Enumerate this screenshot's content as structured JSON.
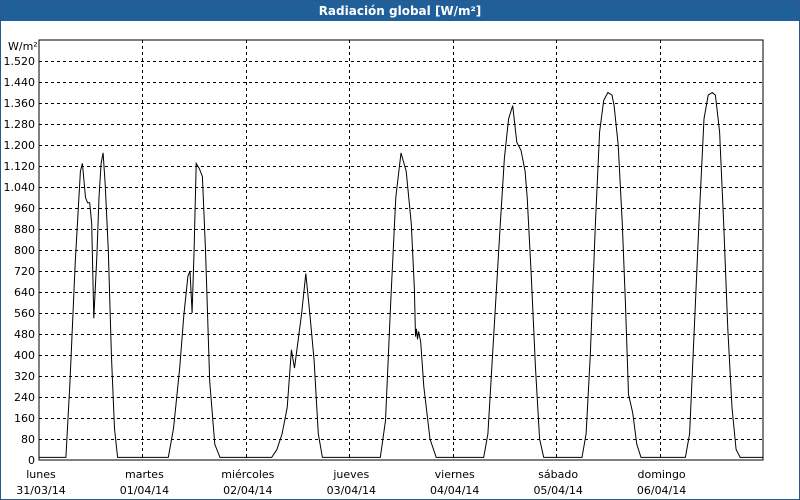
{
  "window": {
    "title": "Radiación global [W/m²]"
  },
  "chart_data": {
    "type": "line",
    "title": "Radiación global [W/m²]",
    "ylabel": "W/m²",
    "xlabel": "",
    "ylim": [
      0,
      1600
    ],
    "xlim": [
      0,
      7
    ],
    "grid": true,
    "y_ticks": [
      0,
      80,
      160,
      240,
      320,
      400,
      480,
      560,
      640,
      720,
      800,
      880,
      960,
      1040,
      1120,
      1200,
      1280,
      1360,
      1440,
      1520
    ],
    "y_tick_labels": [
      "0",
      "80",
      "160",
      "240",
      "320",
      "400",
      "480",
      "560",
      "640",
      "720",
      "800",
      "880",
      "960",
      "1.040",
      "1.120",
      "1.200",
      "1.280",
      "1.360",
      "1.440",
      "1.520"
    ],
    "x_ticks": [
      {
        "day": "lunes",
        "date": "31/03/14"
      },
      {
        "day": "martes",
        "date": "01/04/14"
      },
      {
        "day": "miércoles",
        "date": "02/04/14"
      },
      {
        "day": "jueves",
        "date": "03/04/14"
      },
      {
        "day": "viernes",
        "date": "04/04/14"
      },
      {
        "day": "sábado",
        "date": "05/04/14"
      },
      {
        "day": "domingo",
        "date": "06/04/14"
      }
    ],
    "series": [
      {
        "line_color": "#000000",
        "points": [
          [
            0.0,
            10
          ],
          [
            0.2,
            10
          ],
          [
            0.26,
            10
          ],
          [
            0.3,
            300
          ],
          [
            0.35,
            750
          ],
          [
            0.4,
            1100
          ],
          [
            0.42,
            1130
          ],
          [
            0.45,
            1000
          ],
          [
            0.47,
            980
          ],
          [
            0.49,
            980
          ],
          [
            0.51,
            900
          ],
          [
            0.53,
            540
          ],
          [
            0.56,
            780
          ],
          [
            0.58,
            1000
          ],
          [
            0.6,
            1130
          ],
          [
            0.62,
            1170
          ],
          [
            0.64,
            1050
          ],
          [
            0.67,
            800
          ],
          [
            0.7,
            400
          ],
          [
            0.73,
            120
          ],
          [
            0.76,
            10
          ],
          [
            1.0,
            10
          ],
          [
            1.25,
            10
          ],
          [
            1.3,
            120
          ],
          [
            1.36,
            350
          ],
          [
            1.4,
            550
          ],
          [
            1.44,
            700
          ],
          [
            1.46,
            720
          ],
          [
            1.48,
            560
          ],
          [
            1.5,
            800
          ],
          [
            1.52,
            1130
          ],
          [
            1.55,
            1110
          ],
          [
            1.58,
            1080
          ],
          [
            1.61,
            800
          ],
          [
            1.65,
            300
          ],
          [
            1.7,
            60
          ],
          [
            1.75,
            10
          ],
          [
            2.0,
            10
          ],
          [
            2.25,
            10
          ],
          [
            2.3,
            40
          ],
          [
            2.35,
            100
          ],
          [
            2.4,
            200
          ],
          [
            2.44,
            420
          ],
          [
            2.47,
            350
          ],
          [
            2.5,
            440
          ],
          [
            2.54,
            560
          ],
          [
            2.58,
            710
          ],
          [
            2.62,
            550
          ],
          [
            2.66,
            380
          ],
          [
            2.7,
            100
          ],
          [
            2.74,
            10
          ],
          [
            3.0,
            10
          ],
          [
            3.3,
            10
          ],
          [
            3.35,
            150
          ],
          [
            3.4,
            600
          ],
          [
            3.45,
            1000
          ],
          [
            3.5,
            1170
          ],
          [
            3.55,
            1100
          ],
          [
            3.6,
            900
          ],
          [
            3.63,
            650
          ],
          [
            3.64,
            470
          ],
          [
            3.65,
            500
          ],
          [
            3.66,
            460
          ],
          [
            3.67,
            490
          ],
          [
            3.69,
            450
          ],
          [
            3.72,
            280
          ],
          [
            3.78,
            80
          ],
          [
            3.84,
            10
          ],
          [
            4.0,
            10
          ],
          [
            4.3,
            10
          ],
          [
            4.34,
            100
          ],
          [
            4.4,
            500
          ],
          [
            4.46,
            900
          ],
          [
            4.5,
            1150
          ],
          [
            4.54,
            1300
          ],
          [
            4.58,
            1350
          ],
          [
            4.62,
            1210
          ],
          [
            4.66,
            1180
          ],
          [
            4.7,
            1100
          ],
          [
            4.72,
            1000
          ],
          [
            4.76,
            700
          ],
          [
            4.8,
            350
          ],
          [
            4.84,
            80
          ],
          [
            4.88,
            10
          ],
          [
            5.0,
            10
          ],
          [
            5.25,
            10
          ],
          [
            5.29,
            100
          ],
          [
            5.33,
            400
          ],
          [
            5.38,
            900
          ],
          [
            5.42,
            1250
          ],
          [
            5.46,
            1370
          ],
          [
            5.5,
            1400
          ],
          [
            5.54,
            1390
          ],
          [
            5.56,
            1350
          ],
          [
            5.6,
            1200
          ],
          [
            5.64,
            900
          ],
          [
            5.67,
            600
          ],
          [
            5.7,
            250
          ],
          [
            5.74,
            180
          ],
          [
            5.78,
            60
          ],
          [
            5.82,
            10
          ],
          [
            6.0,
            10
          ],
          [
            6.25,
            10
          ],
          [
            6.29,
            100
          ],
          [
            6.33,
            450
          ],
          [
            6.38,
            900
          ],
          [
            6.43,
            1300
          ],
          [
            6.47,
            1390
          ],
          [
            6.51,
            1400
          ],
          [
            6.54,
            1390
          ],
          [
            6.58,
            1250
          ],
          [
            6.62,
            900
          ],
          [
            6.66,
            500
          ],
          [
            6.7,
            200
          ],
          [
            6.74,
            40
          ],
          [
            6.78,
            10
          ],
          [
            7.0,
            10
          ]
        ]
      }
    ]
  }
}
